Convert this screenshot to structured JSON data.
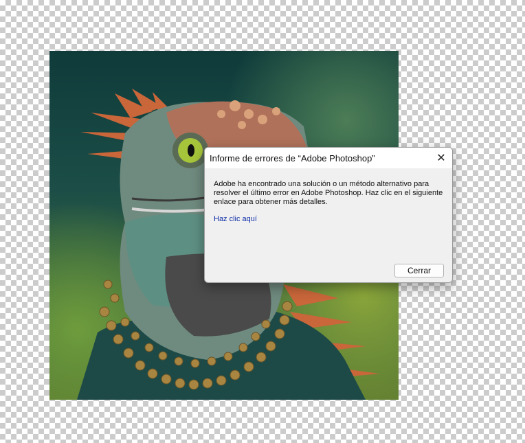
{
  "image": {
    "subject": "iguana-with-bead-necklace"
  },
  "dialog": {
    "title": "Informe de errores de “Adobe Photoshop”",
    "close_icon": "close-icon",
    "close_glyph": "✕",
    "message": "Adobe ha encontrado una solución o un método alternativo para resolver el último error en Adobe Photoshop. Haz clic en el siguiente enlace para obtener más detalles.",
    "link_text": "Haz clic aquí",
    "button_label": "Cerrar"
  },
  "colors": {
    "link": "#0b2ba8",
    "dialog_bg": "#f0f0f0",
    "title_bg": "#ffffff"
  }
}
